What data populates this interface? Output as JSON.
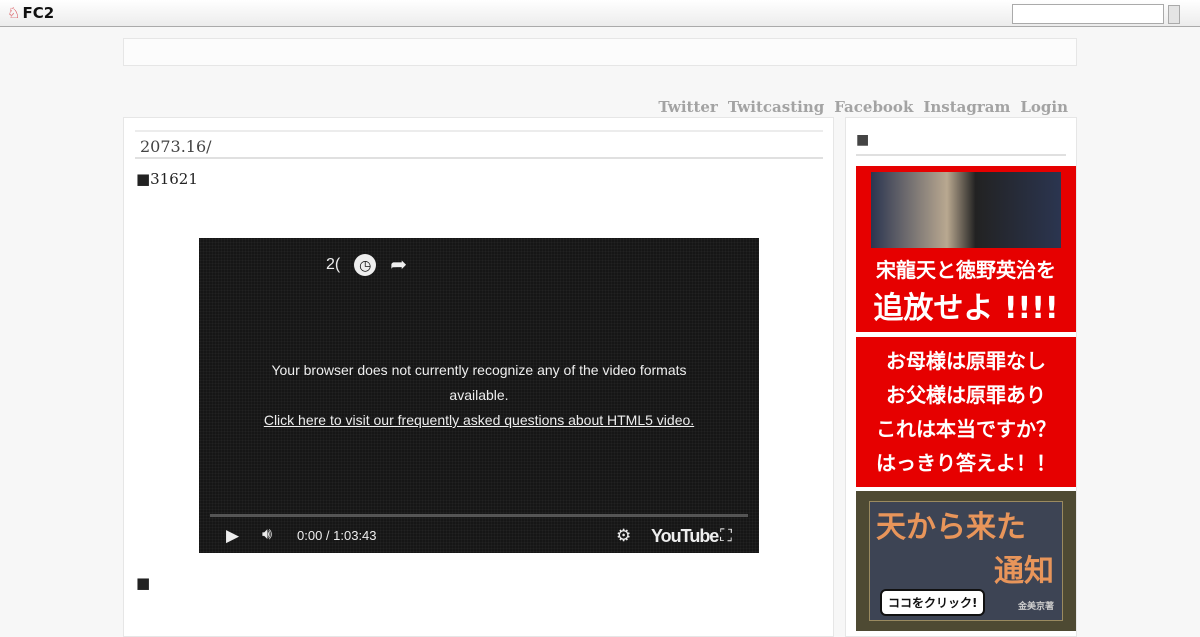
{
  "topbar": {
    "logo": "FC2",
    "search_placeholder": ""
  },
  "nav": [
    "Twitter",
    "Twitcasting",
    "Facebook",
    "Instagram",
    "Login"
  ],
  "entry": {
    "title": "2073.16/",
    "line1": "■31621",
    "line2": "■"
  },
  "video": {
    "top_text": "2(",
    "message": "Your browser does not currently recognize any of the video formats available.",
    "faq_link": "Click here to visit our frequently asked questions about HTML5 video.",
    "time": "0:00 / 1:03:43",
    "brand": "YouTube"
  },
  "sidebar": {
    "title": "■",
    "ad1": {
      "line1": "宋龍天と徳野英治を",
      "line2": "追放せよ !!!!"
    },
    "ad2": {
      "lines": [
        "お母様は原罪なし",
        "お父様は原罪あり",
        "これは本当ですか？",
        "はっきり答えよ！！"
      ]
    },
    "ad3": {
      "title1": "天から来た",
      "title2": "通知",
      "button": "ココをクリック!",
      "author": "金美京著"
    }
  }
}
